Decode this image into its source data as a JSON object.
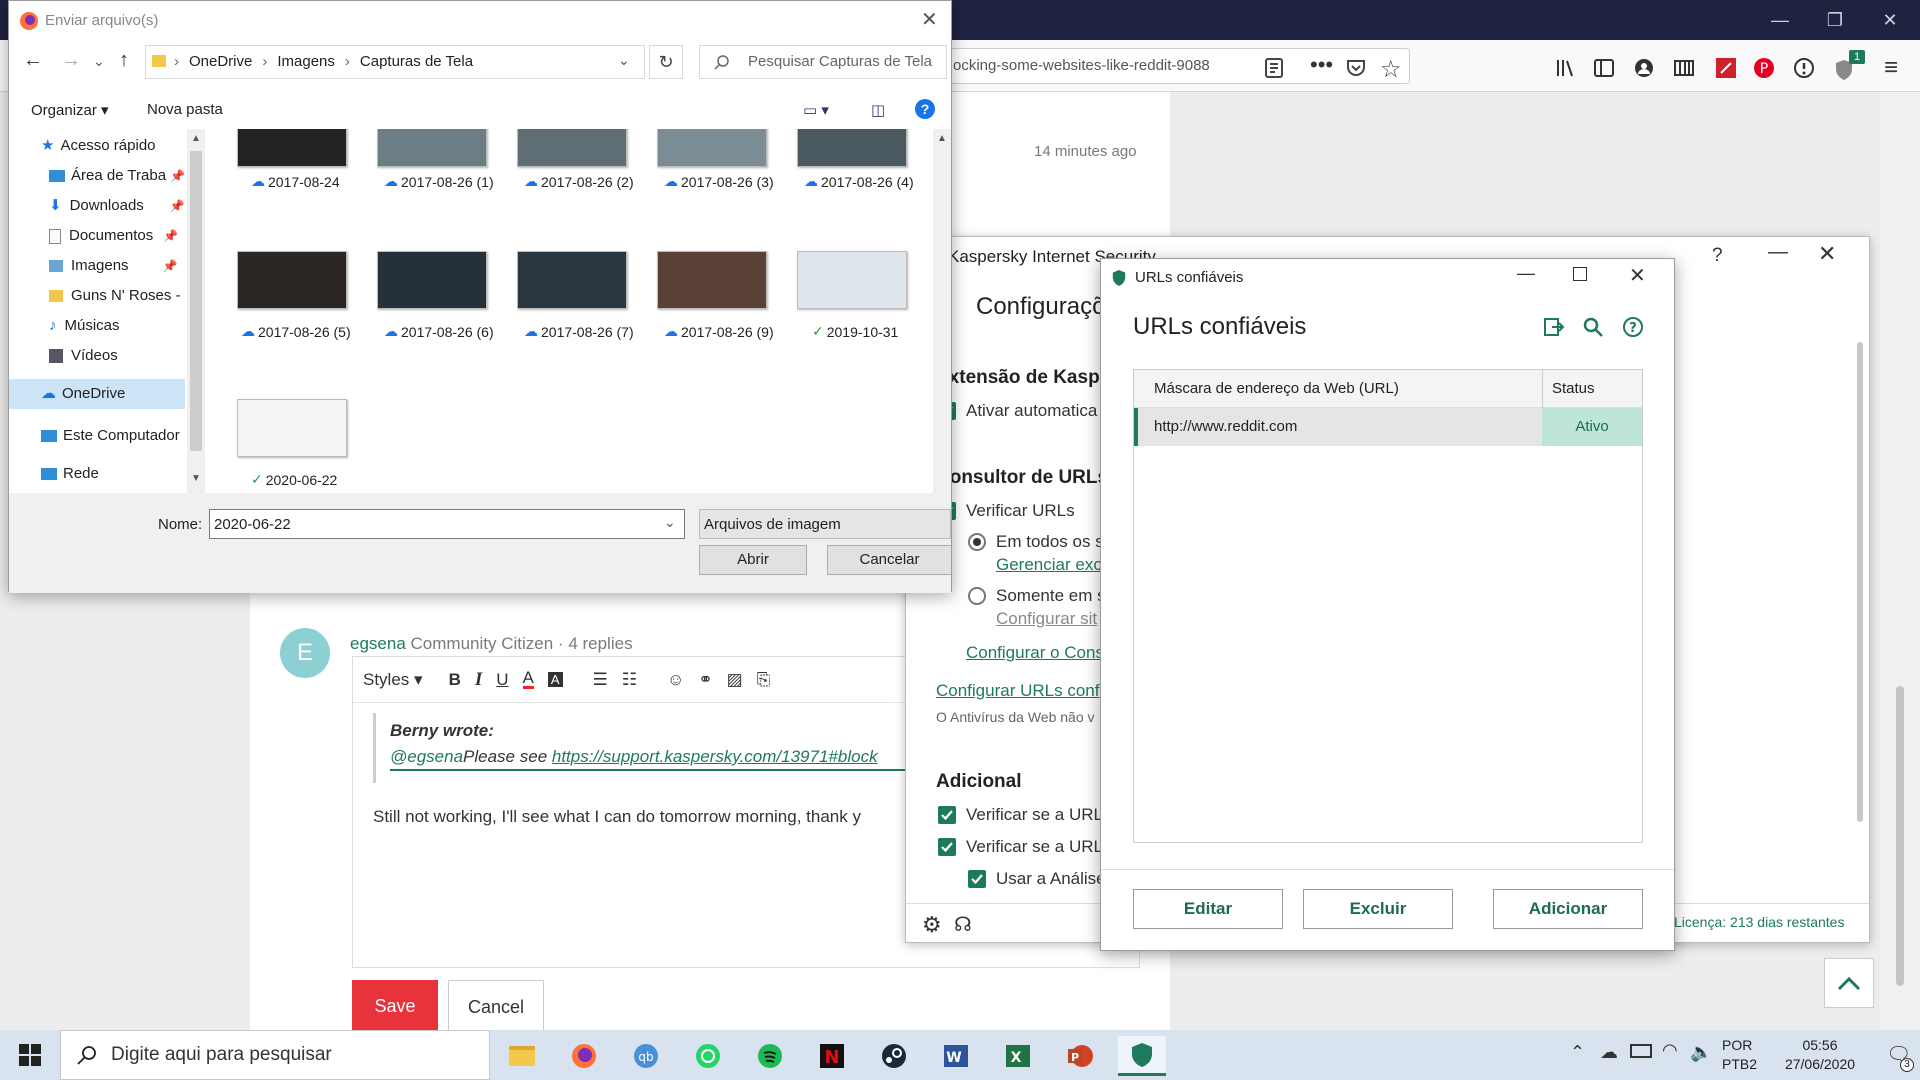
{
  "browser": {
    "url_fragment": "ocking-some-websites-like-reddit-9088",
    "badge_count": "1"
  },
  "page": {
    "timestamp": "14 minutes ago",
    "author": "egsena",
    "role": "Community Citizen",
    "replies": "4 replies",
    "avatar_letter": "E",
    "styles_label": "Styles",
    "quote_author": "Berny wrote:",
    "quote_mention": "@egsena",
    "quote_text": "Please see ",
    "quote_link": "https://support.kaspersky.com/13971#block",
    "reply_text": "Still not working, I'll see what I can do tomorrow morning, thank y",
    "save_label": "Save",
    "cancel_label": "Cancel"
  },
  "kaspersky": {
    "title": "Kaspersky Internet Security",
    "help": "?",
    "heading": "Configuraçõ",
    "section1": "Extensão de Kaspe",
    "s1_check": "Ativar automatica",
    "section2": "Consultor de URLs",
    "s2_check": "Verificar URLs",
    "radio1": "Em todos os s",
    "radio1_link": "Gerenciar exc",
    "radio2": "Somente em s",
    "radio2_link": "Configurar sit",
    "link_config": "Configurar o Cons",
    "link_trusted": "Configurar URLs conf",
    "note": "O Antivírus da Web não v",
    "section3": "Adicional",
    "s3_check1": "Verificar se a URL",
    "s3_check2": "Verificar se a URL",
    "s3_check3": "Usar a Análise",
    "license": "Licença: 213 dias restantes"
  },
  "trusted": {
    "window_title": "URLs confiáveis",
    "heading": "URLs confiáveis",
    "col_mask": "Máscara de endereço da Web (URL)",
    "col_status": "Status",
    "rows": [
      {
        "url": "http://www.reddit.com",
        "status": "Ativo"
      }
    ],
    "btn_edit": "Editar",
    "btn_delete": "Excluir",
    "btn_add": "Adicionar"
  },
  "filedialog": {
    "title": "Enviar arquivo(s)",
    "breadcrumb": [
      "OneDrive",
      "Imagens",
      "Capturas de Tela"
    ],
    "search_placeholder": "Pesquisar Capturas de Tela",
    "organize": "Organizar",
    "new_folder": "Nova pasta",
    "nav": {
      "quick_access": "Acesso rápido",
      "desktop": "Área de Traba",
      "downloads": "Downloads",
      "documents": "Documentos",
      "pictures": "Imagens",
      "guns": "Guns N' Roses -",
      "music": "Músicas",
      "videos": "Vídeos",
      "onedrive": "OneDrive",
      "thispc": "Este Computador",
      "network": "Rede"
    },
    "files": [
      "2017-08-24",
      "2017-08-26 (1)",
      "2017-08-26 (2)",
      "2017-08-26 (3)",
      "2017-08-26 (4)",
      "2017-08-26 (5)",
      "2017-08-26 (6)",
      "2017-08-26 (7)",
      "2017-08-26 (9)",
      "2019-10-31",
      "2020-06-22"
    ],
    "name_label": "Nome:",
    "name_value": "2020-06-22",
    "filetype": "Arquivos de imagem",
    "open": "Abrir",
    "cancel": "Cancelar"
  },
  "taskbar": {
    "search_placeholder": "Digite aqui para pesquisar",
    "lang1": "POR",
    "lang2": "PTB2",
    "time": "05:56",
    "date": "27/06/2020",
    "notif": "3"
  }
}
